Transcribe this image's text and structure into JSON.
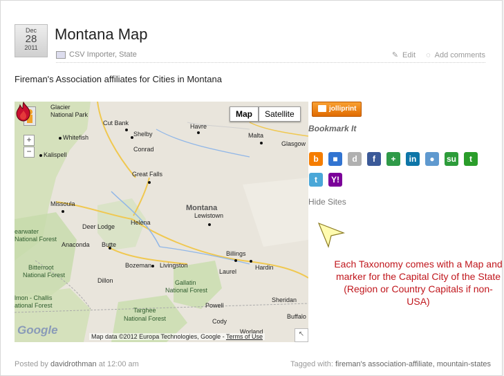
{
  "post": {
    "date": {
      "month": "Dec",
      "day": "28",
      "year": "2011"
    },
    "title": "Montana Map",
    "categories": "CSV Importer, State",
    "edit_label": "Edit",
    "comments_label": "Add comments",
    "intro": "Fireman's Association affiliates for Cities in Montana"
  },
  "map": {
    "type_buttons": [
      "Map",
      "Satellite"
    ],
    "zoom_in": "+",
    "zoom_out": "−",
    "google_logo": "Google",
    "attribution": "Map data ©2012 Europa Technologies, Google -",
    "terms": "Terms of Use",
    "state_label": "Montana",
    "places": {
      "glacier": "Glacier",
      "glacier_np": "National Park",
      "cut_bank": "Cut Bank",
      "havre": "Havre",
      "shelby": "Shelby",
      "whitefish": "Whitefish",
      "malta": "Malta",
      "conrad": "Conrad",
      "glasgow": "Glasgow",
      "kalispell": "Kalispell",
      "great_falls": "Great Falls",
      "lewistown": "Lewistown",
      "missoula": "Missoula",
      "helena": "Helena",
      "deer_lodge": "Deer Lodge",
      "bearwater": "earwater",
      "nf1": "National Forest",
      "anaconda": "Anaconda",
      "butte": "Butte",
      "billings": "Billings",
      "bitterroot": "Bitterroot",
      "nf2": "National Forest",
      "bozeman": "Bozeman",
      "livingston": "Livingston",
      "hardin": "Hardin",
      "laurel": "Laurel",
      "dillon": "Dillon",
      "gallatin": "Gallatin",
      "nf3": "National Forest",
      "salmon": "lmon - Challis",
      "nf4": "ational Forest",
      "sheridan": "Sheridan",
      "powell": "Powell",
      "targhee": "Targhee",
      "nf5": "National Forest",
      "cody": "Cody",
      "buffalo": "Buffalo",
      "worland": "Worland"
    },
    "corner_icon": "↖"
  },
  "sidebar": {
    "jolliprint_label": "jolliprint",
    "bookmark_label": "Bookmark It",
    "social": [
      {
        "name": "blogger",
        "glyph": "b",
        "color": "#f57d00"
      },
      {
        "name": "delicious",
        "glyph": "■",
        "color": "#3274d1"
      },
      {
        "name": "digg",
        "glyph": "d",
        "color": "#b0b0b0"
      },
      {
        "name": "facebook",
        "glyph": "f",
        "color": "#3b5998"
      },
      {
        "name": "google",
        "glyph": "+",
        "color": "#2f9a48"
      },
      {
        "name": "linkedin",
        "glyph": "in",
        "color": "#0e76a8"
      },
      {
        "name": "reddit",
        "glyph": "●",
        "color": "#5f99cf"
      },
      {
        "name": "stumbleupon",
        "glyph": "su",
        "color": "#2d9c3a"
      },
      {
        "name": "technorati",
        "glyph": "t",
        "color": "#2a9d2a"
      },
      {
        "name": "twitter",
        "glyph": "t",
        "color": "#4aa7d8"
      },
      {
        "name": "yahoo",
        "glyph": "Y!",
        "color": "#7b0099"
      }
    ],
    "hide_sites": "Hide Sites"
  },
  "annotation": {
    "text": "Each Taxonomy comes with a Map and marker for the Capital City of the State (Region or Country Capitals if non-USA)"
  },
  "footer": {
    "posted_by_label": "Posted by",
    "author": "davidrothman",
    "at_label": "at",
    "time": "12:00 am",
    "tagged_label": "Tagged with:",
    "tags": "fireman's association-affiliate, mountain-states"
  },
  "colors": {
    "callout_text": "#c0161c",
    "jolliprint": "#f08a1c",
    "marker": "#c8102e"
  }
}
